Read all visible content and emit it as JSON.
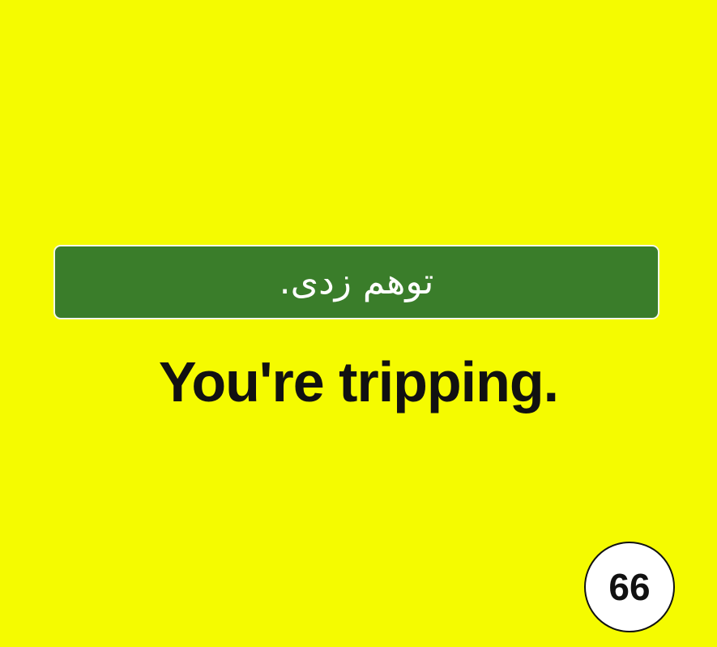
{
  "card": {
    "background_color": "#f5fb00",
    "persian_phrase": "توهم زدی.",
    "english_phrase": "You're tripping.",
    "banner_color": "#3a7d2a",
    "page_number": "66"
  }
}
